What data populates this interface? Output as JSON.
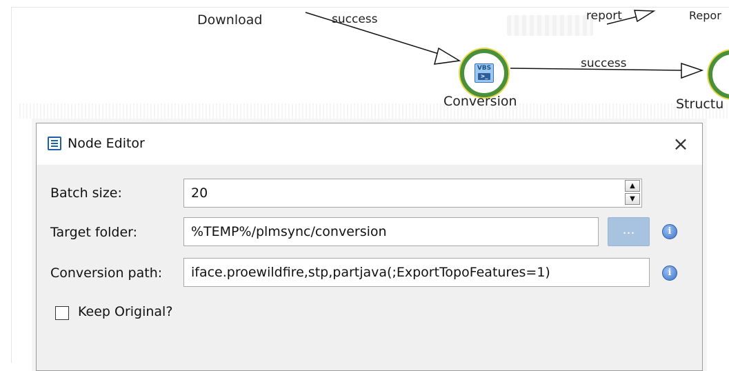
{
  "workflow": {
    "nodes": {
      "download_label": "Download",
      "conversion_label": "Conversion",
      "structure_label": "Structu",
      "report_label": "Repor"
    },
    "node_icon_text": "VBS",
    "edges": {
      "success_top": "success",
      "report": "report",
      "success_right": "success"
    },
    "colors": {
      "node_ring": "#4a8f3a",
      "node_highlight": "#e8d84a",
      "icon_blue": "#3b74b5"
    }
  },
  "dialog": {
    "title": "Node Editor",
    "close_label": "×",
    "fields": {
      "batch_size": {
        "label": "Batch size:",
        "value": "20"
      },
      "target_folder": {
        "label": "Target folder:",
        "value": "%TEMP%/plmsync/conversion",
        "browse_label": "..."
      },
      "conversion_path": {
        "label": "Conversion path:",
        "value": "iface.proewildfire,stp,partjava(;ExportTopoFeatures=1)"
      }
    },
    "keep_original": {
      "label": "Keep Original?",
      "checked": false
    },
    "spinner": {
      "up": "▲",
      "down": "▼"
    },
    "info_icon_glyph": "i"
  }
}
